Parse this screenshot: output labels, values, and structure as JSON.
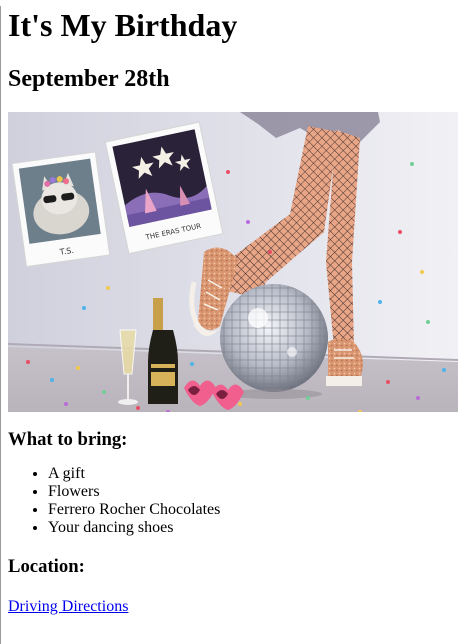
{
  "page": {
    "title": "It's My Birthday",
    "date": "September 28th",
    "photo": {
      "polaroid_left_caption": "T.S.",
      "polaroid_right_caption": "THE ERAS TOUR"
    },
    "bring": {
      "heading": "What to bring:",
      "items": [
        "A gift",
        "Flowers",
        "Ferrero Rocher Chocolates",
        "Your dancing shoes"
      ]
    },
    "location": {
      "heading": "Location:",
      "link_text": "Driving Directions"
    }
  },
  "colors": {
    "link": "#0000ee",
    "photo_wall": "#d9dae4",
    "photo_floor": "#cfc9cf"
  }
}
